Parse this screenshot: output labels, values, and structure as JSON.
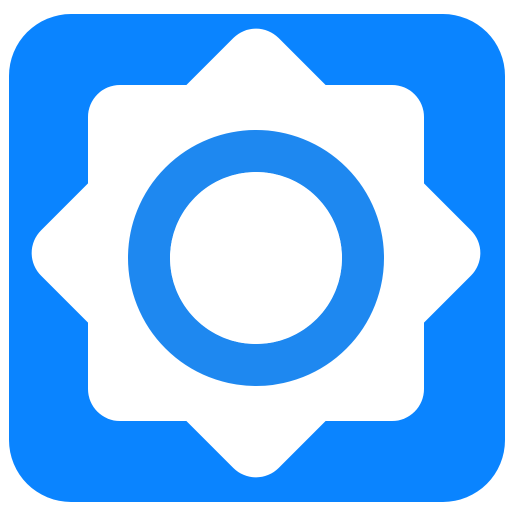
{
  "icon": {
    "name": "settings-gear-icon",
    "background_color": "#0A84FF",
    "shape_color": "#FFFFFF",
    "ring_color": "#1E88F0"
  }
}
